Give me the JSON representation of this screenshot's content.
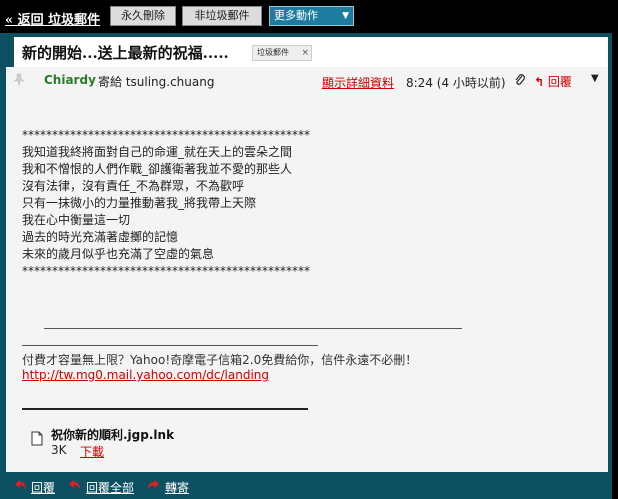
{
  "toolbar": {
    "back_label": "« 返回 垃圾郵件",
    "delete_label": "永久刪除",
    "notspam_label": "非垃圾郵件",
    "more_label": "更多動作",
    "more_caret": "▼"
  },
  "subject": {
    "title": "新的開始...送上最新的祝福.....",
    "tag_label": "垃圾郵件",
    "tag_close": "×"
  },
  "header": {
    "sender": "Chiardy",
    "to_text": "寄給 tsuling.chuang",
    "details_link": "顯示詳細資料",
    "time": "8:24 (4 小時以前)",
    "reply_label": "回覆",
    "menu_caret": "▼"
  },
  "body": {
    "lines": [
      "************************************************",
      "我知道我終將面對自己的命運_就在天上的雲朵之間",
      "我和不憎恨的人們作戰_卻護衛著我並不愛的那些人",
      "沒有法律，沒有責任_不為群眾，不為歡呼",
      "只有一抹微小的力量推動著我_將我帶上天際",
      "我在心中衡量這一切",
      "過去的時光充滿著虛擲的記憶",
      "未來的歲月似乎也充滿了空虛的氣息",
      "************************************************"
    ],
    "promo": "付費才容量無上限？Yahoo!奇摩電子信箱2.0免費給你，信件永遠不必刪！",
    "promo_link": "http://tw.mg0.mail.yahoo.com/dc/landing"
  },
  "attachment": {
    "name": "祝你新的順利.jgp.lnk",
    "size": "3K",
    "download_label": "下載"
  },
  "bottom": {
    "reply_label": "回覆",
    "reply_all_label": "回覆全部",
    "forward_label": "轉寄"
  },
  "colors": {
    "accent": "#0d5062",
    "link": "#cc0000",
    "sender": "#2a7a2a"
  }
}
